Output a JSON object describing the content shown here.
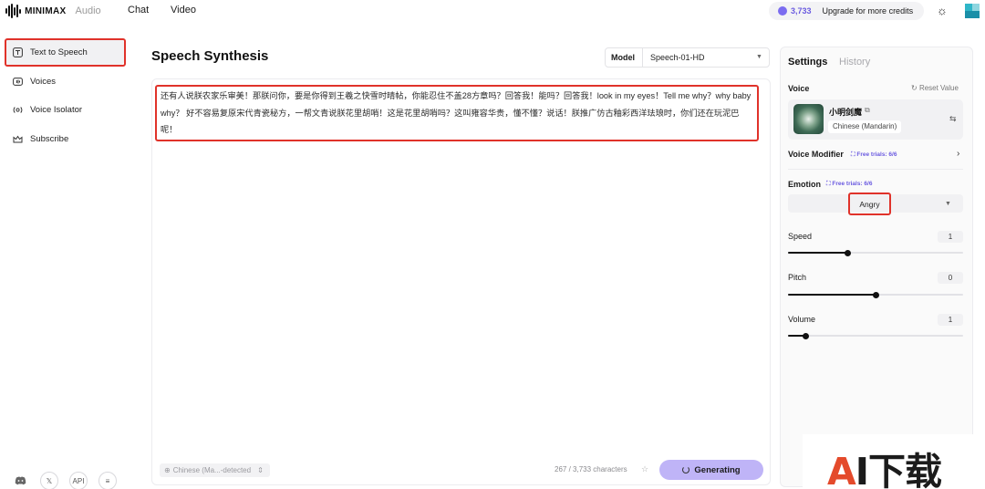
{
  "topbar": {
    "logo_text": "MINIMAX",
    "logo_sub": "Audio",
    "nav": [
      "Chat",
      "Video"
    ],
    "credits_value": "3,733",
    "upgrade_label": "Upgrade for more credits"
  },
  "sidebar": {
    "items": [
      {
        "label": "Text to Speech",
        "icon": "text-to-speech-icon"
      },
      {
        "label": "Voices",
        "icon": "voices-icon"
      },
      {
        "label": "Voice Isolator",
        "icon": "voice-isolator-icon"
      },
      {
        "label": "Subscribe",
        "icon": "subscribe-icon"
      }
    ],
    "bottom": {
      "api_label": "API"
    }
  },
  "main": {
    "title": "Speech Synthesis",
    "model_label": "Model",
    "model_value": "Speech-01-HD",
    "text": "还有人说朕农家乐审美！那朕问你，要是你得到王羲之快雪时晴帖，你能忍住不盖28方章吗？回答我！能吗？回答我！look in my eyes！Tell me why？why baby why？ 好不容易复原宋代青瓷秘方，一帮文青说朕花里胡哨！这是花里胡哨吗？这叫雍容华贵，懂不懂？说话！朕推广仿古釉彩西洋珐琅时，你们还在玩泥巴呢！",
    "language": "Chinese (Ma...-detected",
    "char_count": "267 / 3,733 characters",
    "generate_label": "Generating"
  },
  "settings": {
    "tab_settings": "Settings",
    "tab_history": "History",
    "voice_label": "Voice",
    "reset_label": "Reset Value",
    "voice_name": "小明剑魔",
    "voice_lang": "Chinese (Mandarin)",
    "voice_modifier_label": "Voice Modifier",
    "free_trials": "Free trials: 6/6",
    "emotion_label": "Emotion",
    "emotion_value": "Angry",
    "speed": {
      "label": "Speed",
      "value": "1",
      "level": 0.34
    },
    "pitch": {
      "label": "Pitch",
      "value": "0",
      "level": 0.5
    },
    "volume": {
      "label": "Volume",
      "value": "1",
      "level": 0.1
    }
  },
  "watermark": {
    "text_a": "A",
    "text_rest": "I下载"
  },
  "colors": {
    "accent": "#6a5ae0",
    "highlight": "#e0322a",
    "button": "#bfb4f7"
  }
}
